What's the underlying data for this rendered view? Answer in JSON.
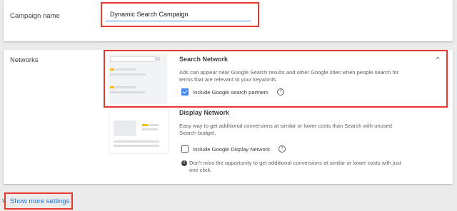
{
  "campaign_name": {
    "label": "Campaign name",
    "value": "Dynamic Search Campaign"
  },
  "networks": {
    "label": "Networks",
    "search": {
      "title": "Search Network",
      "description_line1": "Ads can appear near Google Search results and other Google sites when people search for",
      "description_line2": "terms that are relevant to your keywords",
      "checkbox_label": "Include Google search partners",
      "checked": true
    },
    "display": {
      "title": "Display Network",
      "description_line1": "Easy way to get additional conversions at similar or lower costs than Search with unused",
      "description_line2": "Search budget.",
      "checkbox_label": "Include Google Display Network",
      "checked": false,
      "note_line1": "Don't miss the opportunity to get additional conversions at similar or lower costs with just",
      "note_line2": "one click."
    }
  },
  "footer": {
    "show_more_label": "Show more settings"
  },
  "icons": {
    "help": "?",
    "info": "!",
    "chevron_up": "^",
    "chevron_down": "v"
  },
  "colors": {
    "accent": "#4285f4",
    "link": "#1a73e8",
    "highlight": "#e8392f",
    "thumb_yellow": "#fbbc04"
  }
}
